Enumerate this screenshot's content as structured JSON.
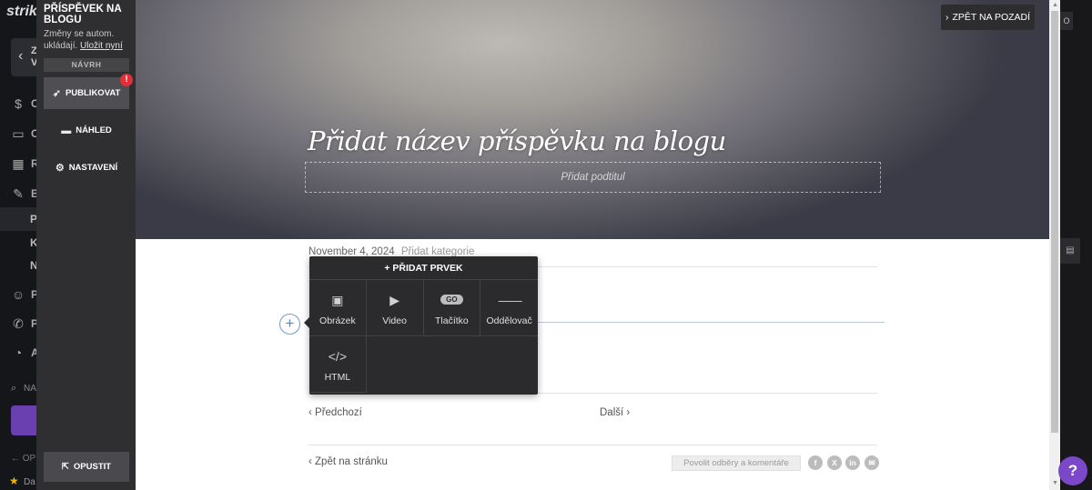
{
  "app_sidebar": {
    "logo": "strik",
    "back_label": "Z\nV",
    "nav_items": [
      {
        "icon": "dollar-icon",
        "glyph": "$",
        "letter": "C"
      },
      {
        "icon": "store-icon",
        "glyph": "▭",
        "letter": "O"
      },
      {
        "icon": "calendar-icon",
        "glyph": "▦",
        "letter": "R"
      },
      {
        "icon": "pen-icon",
        "glyph": "✎",
        "letter": "B"
      }
    ],
    "sub_items": [
      "P",
      "K",
      "N"
    ],
    "nav_items_2": [
      {
        "icon": "people-icon",
        "glyph": "☺",
        "letter": "P"
      },
      {
        "icon": "megaphone-icon",
        "glyph": "✆",
        "letter": "P"
      },
      {
        "icon": "chart-icon",
        "glyph": "◔",
        "letter": "A"
      }
    ],
    "search_label": "NA",
    "op_label": "← OP",
    "star_label": "Da"
  },
  "editor_panel": {
    "title": "PŘÍSPĚVEK NA BLOGU",
    "autosave_text": "Změny se autom. ukládají.",
    "save_now_link": "Uložit nyní",
    "status_badge": "NÁVRH",
    "publish_label": "PUBLIKOVAT",
    "publish_alert": "!",
    "preview_label": "NÁHLED",
    "settings_label": "NASTAVENÍ",
    "exit_label": "OPUSTIT"
  },
  "hero": {
    "back_to_bg_label": "ZPĚT NA POZADÍ",
    "post_title": "Přidat název příspěvku na blogu",
    "subtitle_placeholder": "Přidat podtitul"
  },
  "post": {
    "date": "November 4, 2024",
    "add_category": "Přidat kategorie",
    "prev_label": "Předchozí",
    "next_label": "Další",
    "back_to_page": "Zpět na stránku",
    "enable_subscriptions": "Povolit odběry a komentáře",
    "social_icons": [
      {
        "name": "facebook-icon",
        "glyph": "f"
      },
      {
        "name": "x-icon",
        "glyph": "X"
      },
      {
        "name": "linkedin-icon",
        "glyph": "in"
      },
      {
        "name": "email-icon",
        "glyph": "✉"
      }
    ]
  },
  "add_element_popup": {
    "title": "+ PŘIDAT PRVEK",
    "items": [
      {
        "icon": "image-icon",
        "glyph": "▣",
        "label": "Obrázek"
      },
      {
        "icon": "video-icon",
        "glyph": "▶",
        "label": "Video"
      },
      {
        "icon": "button-icon",
        "glyph": "GO",
        "label": "Tlačítko"
      },
      {
        "icon": "divider-icon",
        "glyph": "——",
        "label": "Oddělovač"
      },
      {
        "icon": "code-icon",
        "glyph": "</>",
        "label": "HTML"
      }
    ]
  },
  "right_edge": {
    "top_button": "O",
    "help_label": "?"
  }
}
